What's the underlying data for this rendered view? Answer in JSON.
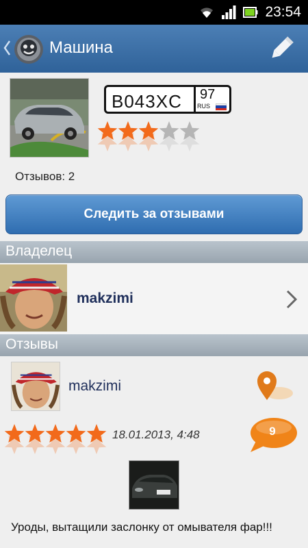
{
  "status_bar": {
    "time": "23:54"
  },
  "action_bar": {
    "title": "Машина"
  },
  "car": {
    "plate": {
      "number": "B043XC",
      "region": "97",
      "country": "RUS"
    },
    "rating": 3,
    "rating_max": 5,
    "reviews_count": "Отзывов: 2"
  },
  "follow_button": {
    "label": "Следить за отзывами"
  },
  "sections": {
    "owner": "Владелец",
    "reviews": "Отзывы"
  },
  "owner": {
    "name": "makzimi"
  },
  "review": {
    "author": "makzimi",
    "rating": 5,
    "rating_max": 5,
    "date": "18.01.2013, 4:48",
    "comments_count": "9",
    "text": "Уроды, вытащили заслонку от омывателя фар!!!"
  },
  "colors": {
    "action_bar": "#3a6ea5",
    "star_filled": "#f26a1b",
    "star_empty": "#b5b5b5",
    "accent_orange": "#f28c1e"
  }
}
